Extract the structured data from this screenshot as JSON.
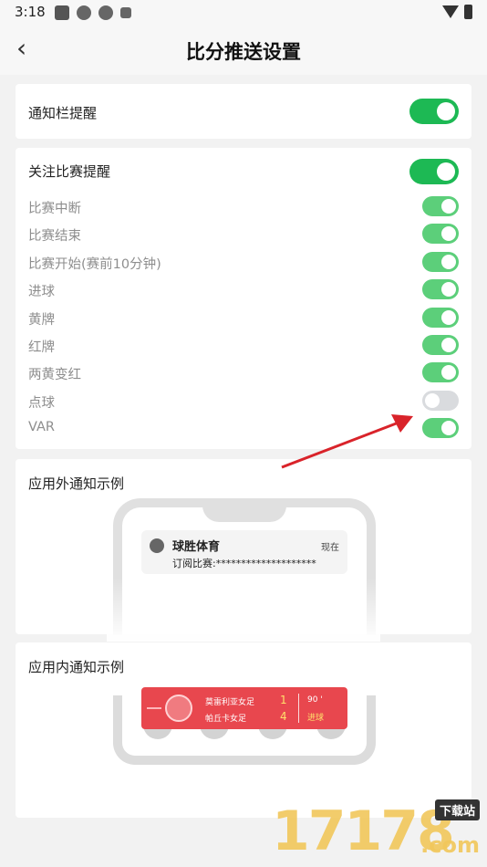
{
  "status_bar": {
    "time": "3:18"
  },
  "header": {
    "back_symbol": "‹",
    "title": "比分推送设置"
  },
  "notification_bar": {
    "label": "通知栏提醒",
    "enabled": true
  },
  "followed_matches": {
    "label": "关注比赛提醒",
    "enabled": true,
    "items": [
      {
        "label": "比赛中断",
        "enabled": true
      },
      {
        "label": "比赛结束",
        "enabled": true
      },
      {
        "label": "比赛开始(赛前10分钟)",
        "enabled": true
      },
      {
        "label": "进球",
        "enabled": true
      },
      {
        "label": "黄牌",
        "enabled": true
      },
      {
        "label": "红牌",
        "enabled": true
      },
      {
        "label": "两黄变红",
        "enabled": true
      },
      {
        "label": "点球",
        "enabled": false
      },
      {
        "label": "VAR",
        "enabled": true
      }
    ]
  },
  "outside_example": {
    "title": "应用外通知示例",
    "app_name": "球胜体育",
    "time": "现在",
    "body": "订阅比赛:********************"
  },
  "inside_example": {
    "title": "应用内通知示例",
    "home_team": "莫雷利亚女足",
    "away_team": "帕丘卡女足",
    "home_score": "1",
    "away_score": "4",
    "minute": "90 '",
    "event": "进球"
  },
  "watermark": {
    "number": "17178",
    "site": "下载站",
    "domain": ".com"
  },
  "colors": {
    "toggle_on": "#1db954",
    "toggle_on_sub": "#5ccf7a",
    "toggle_off": "#d9dbde",
    "banner": "#e8474e",
    "arrow": "#d9232a"
  }
}
